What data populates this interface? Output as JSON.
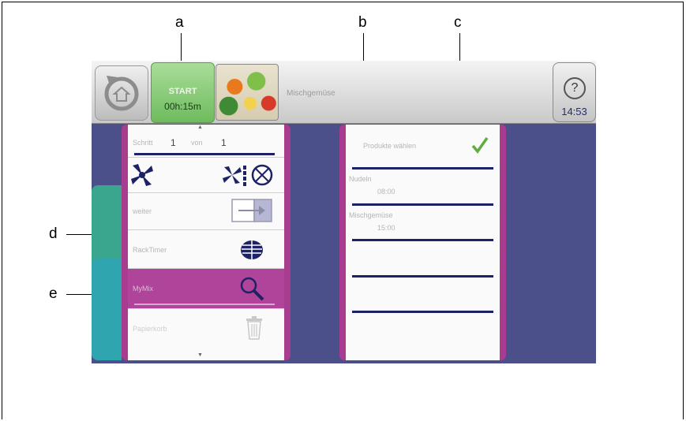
{
  "callouts": {
    "a": "a",
    "b": "b",
    "c": "c",
    "d": "d",
    "e": "e"
  },
  "topbar": {
    "start_label": "START",
    "start_time": "00h:15m",
    "program_name": "Mischgemüse",
    "help_symbol": "?",
    "clock": "14:53"
  },
  "left_panel": {
    "step_label": "Schritt",
    "step_current": "1",
    "step_of": "von",
    "step_total": "1",
    "weiter_label": "weiter",
    "racktimer_label": "RackTimer",
    "highlighted_label": "MyMix",
    "delete_label": "Papierkorb"
  },
  "right_panel": {
    "select_label": "Produkte wählen",
    "item1_name": "Nudeln",
    "item1_time": "08:00",
    "item2_name": "Mischgemüse",
    "item2_time": "15:00"
  },
  "icons": [
    "back-icon",
    "help-icon",
    "fan-icon",
    "fan-speed-icon",
    "weiter-arrow-icon",
    "racktimer-icon",
    "search-icon",
    "trash-icon",
    "checkmark-icon"
  ],
  "colors": {
    "accent_magenta": "#a83c8f",
    "start_green": "#8ccf7a",
    "background_blue": "#4b4f8a",
    "line_navy": "#1d2266"
  }
}
